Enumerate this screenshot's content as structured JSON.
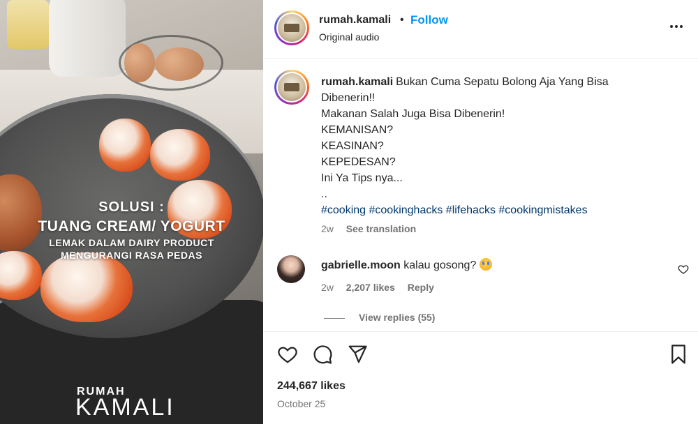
{
  "media": {
    "overlay_line1": "SOLUSI :",
    "overlay_line2": "TUANG CREAM/ YOGURT",
    "overlay_line3": "LEMAK DALAM DAIRY PRODUCT",
    "overlay_line4": "MENGURANGI RASA PEDAS",
    "brand_top": "RUMAH",
    "brand_bottom": "KAMALI"
  },
  "header": {
    "username": "rumah.kamali",
    "separator": "•",
    "follow_label": "Follow",
    "audio_label": "Original audio",
    "more_icon": "more-horizontal-icon"
  },
  "caption": {
    "username": "rumah.kamali",
    "line1": "Bukan Cuma Sepatu Bolong Aja Yang Bisa",
    "line2": "Dibenerin!!",
    "line3": "Makanan Salah Juga Bisa Dibenerin!",
    "line4": "KEMANISAN?",
    "line5": "KEASINAN?",
    "line6": "KEPEDESAN?",
    "line7": "Ini Ya Tips nya...",
    "line8": "..",
    "hashtags": [
      "#cooking",
      "#cookinghacks",
      "#lifehacks",
      "#cookingmistakes"
    ],
    "time": "2w",
    "see_translation": "See translation"
  },
  "comment": {
    "username": "gabrielle.moon",
    "text": "kalau gosong?",
    "time": "2w",
    "likes": "2,207 likes",
    "reply_label": "Reply",
    "view_replies": "View replies (55)"
  },
  "post": {
    "likes": "244,667 likes",
    "date": "October 25"
  },
  "colors": {
    "follow": "#0095f6",
    "hashtag": "#00376b",
    "muted": "#737373",
    "text": "#262626"
  }
}
